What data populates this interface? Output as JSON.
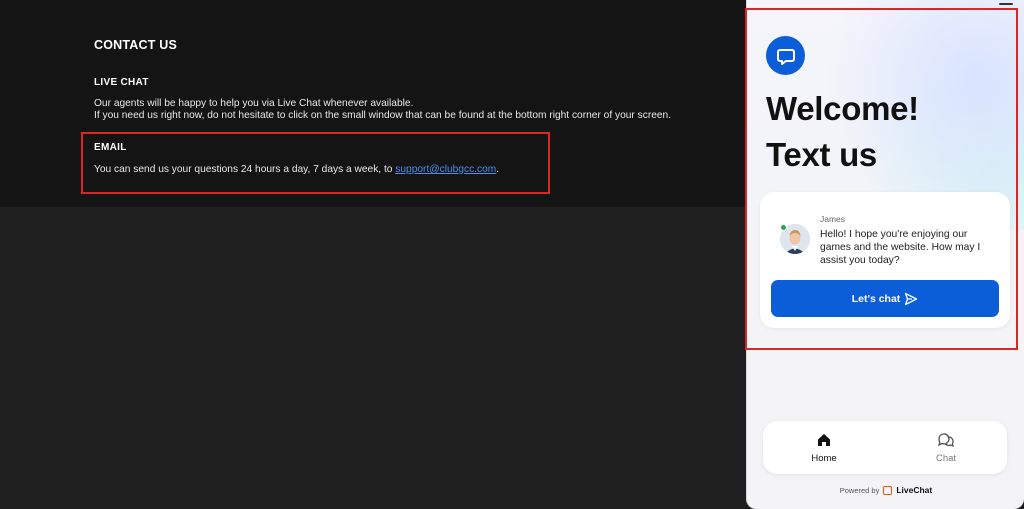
{
  "contact": {
    "title": "CONTACT US",
    "live_chat_heading": "LIVE CHAT",
    "live_chat_line1": "Our agents will be happy to help you via Live Chat whenever available.",
    "live_chat_line2": "If you need us right now, do not hesitate to click on the small window that can be found at the bottom right corner of your screen.",
    "email_heading": "EMAIL",
    "email_text": "You can send us your questions 24 hours a day, 7 days a week, to ",
    "email_link": "support@clubgcc.com",
    "email_trailing": "."
  },
  "widget": {
    "welcome_line1": "Welcome!",
    "welcome_line2": "Text us",
    "agent_name": "James",
    "agent_message": "Hello! I hope you're enjoying our games and the website. How may I assist you today?",
    "chat_button": "Let's chat",
    "nav": [
      {
        "label": "Home",
        "icon": "home-icon",
        "active": true
      },
      {
        "label": "Chat",
        "icon": "chat-bubbles-icon",
        "active": false
      }
    ],
    "powered_by": "Powered by",
    "brand": "LiveChat"
  },
  "colors": {
    "highlight": "#d62828",
    "accent_blue": "#0b5ed7",
    "link_blue": "#4a8ef0",
    "online_green": "#2ea44f",
    "livechat_orange": "#ff5100"
  }
}
